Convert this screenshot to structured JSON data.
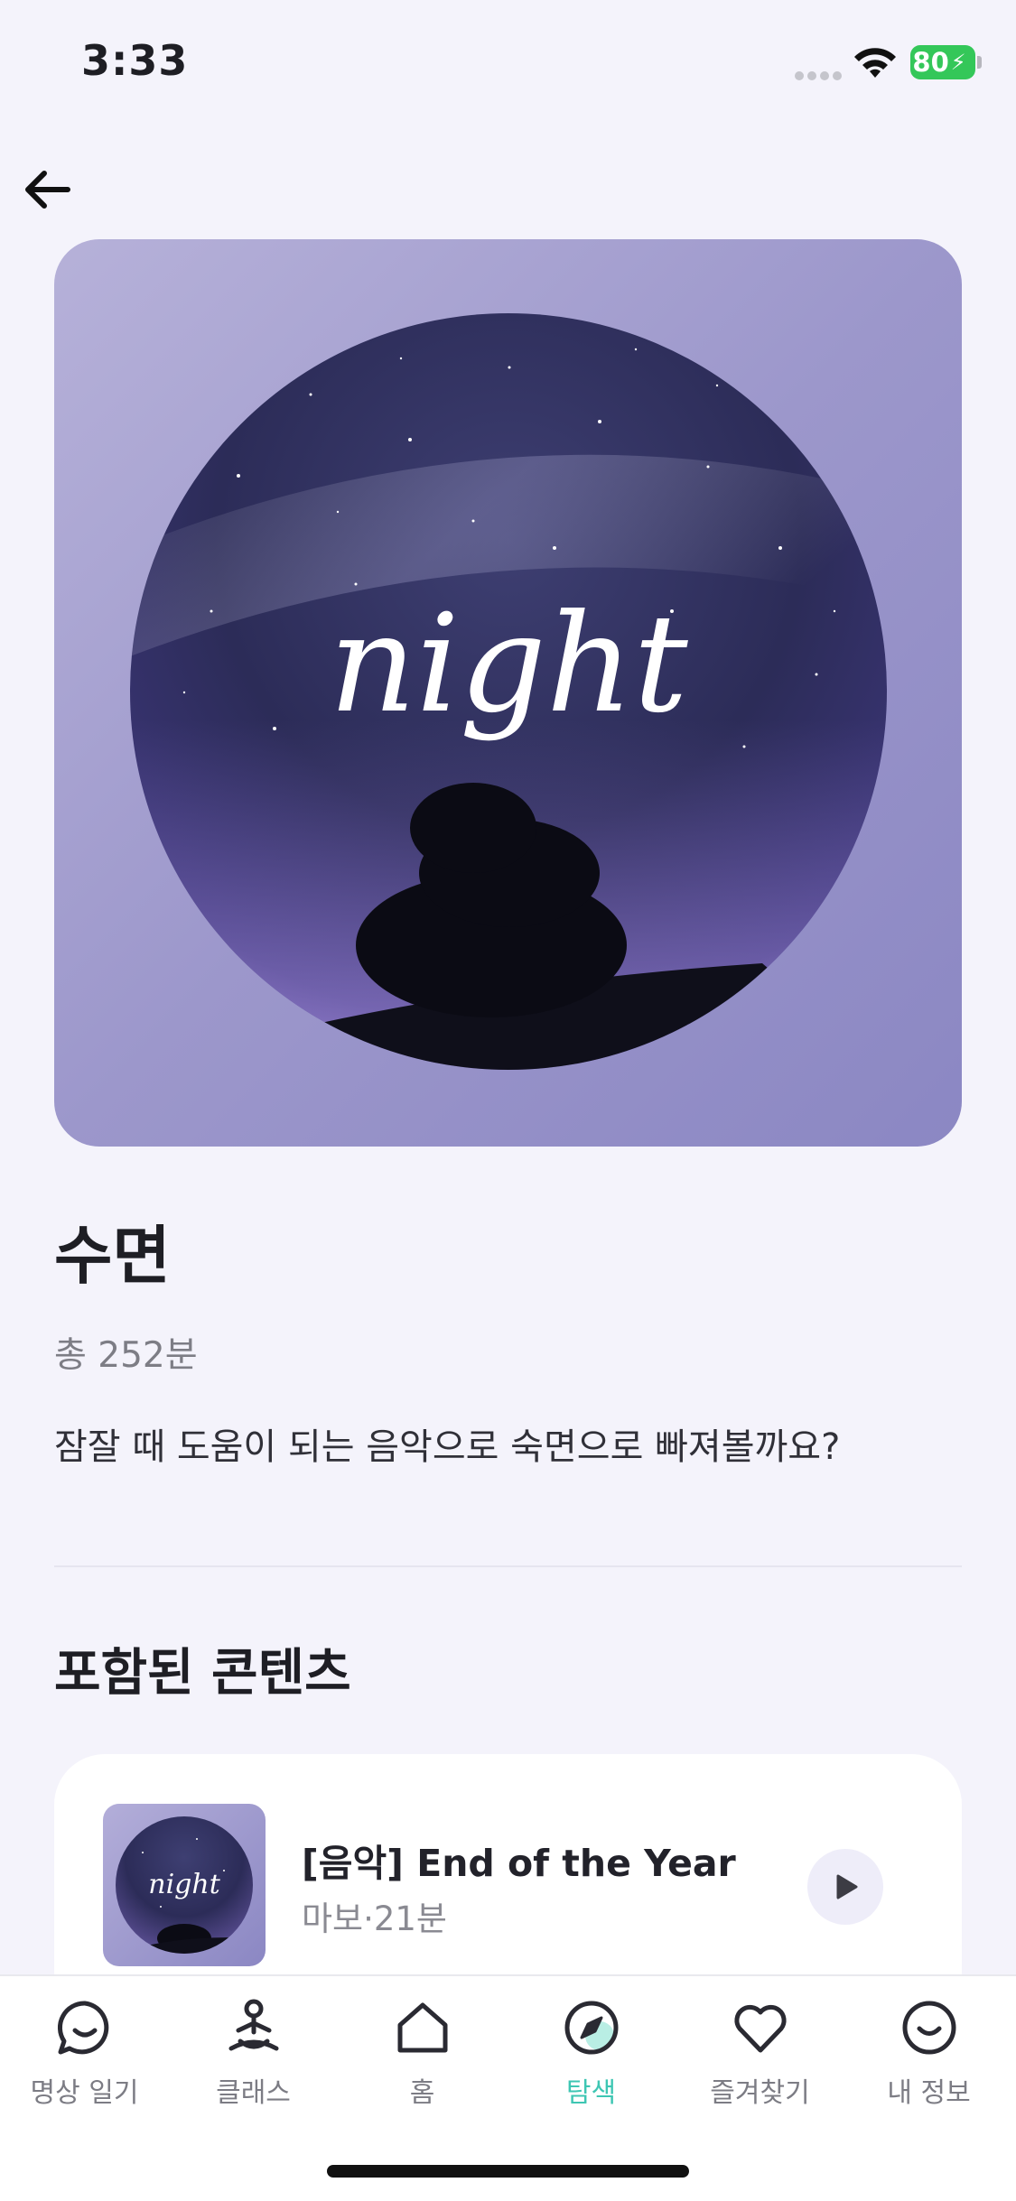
{
  "status_bar": {
    "time": "3:33",
    "battery": "80"
  },
  "hero": {
    "artwork_text": "night"
  },
  "collection": {
    "title": "수면",
    "duration": "총 252분",
    "description": "잠잘 때 도움이 되는 음악으로 숙면으로 빠져볼까요?"
  },
  "section": {
    "title": "포함된 콘텐츠"
  },
  "tracks": [
    {
      "title": "[음악] End of the Year",
      "meta": "마보·21분",
      "thumb_text": "night"
    }
  ],
  "tab_bar": {
    "active": "탐색",
    "accent_color": "#3ec6b3",
    "items": [
      {
        "label": "명상 일기",
        "icon": "chat-smile-icon"
      },
      {
        "label": "클래스",
        "icon": "meditation-person-icon"
      },
      {
        "label": "홈",
        "icon": "home-icon"
      },
      {
        "label": "탐색",
        "icon": "compass-icon"
      },
      {
        "label": "즐겨찾기",
        "icon": "heart-icon"
      },
      {
        "label": "내 정보",
        "icon": "smile-face-icon"
      }
    ]
  }
}
